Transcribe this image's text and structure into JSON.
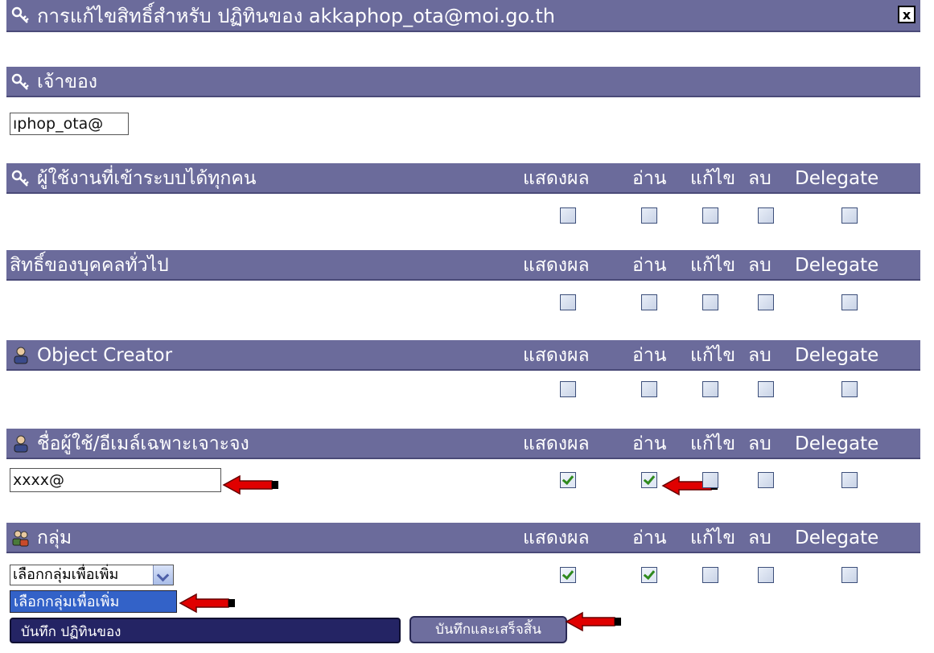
{
  "title_bar": {
    "title": "การแก้ไขสิทธิ์สำหรับ ปฏิทินของ akkaphop_ota@moi.go.th",
    "close_label": "x"
  },
  "owner": {
    "label": "เจ้าของ",
    "value": "ıphop_ota@"
  },
  "columns": [
    "แสดงผล",
    "อ่าน",
    "แก้ไข",
    "ลบ",
    "Delegate"
  ],
  "sections": [
    {
      "label": "ผู้ใช้งานที่เข้าระบบได้ทุกคน",
      "checks": [
        false,
        false,
        false,
        false,
        false
      ]
    },
    {
      "label": "สิทธิ์ของบุคคลทั่วไป",
      "checks": [
        false,
        false,
        false,
        false,
        false
      ]
    },
    {
      "label": "Object Creator",
      "checks": [
        false,
        false,
        false,
        false,
        false
      ]
    },
    {
      "label": "ชื่อผู้ใช้/อีเมล์เฉพาะเจาะจง",
      "checks": [
        true,
        true,
        false,
        false,
        false
      ],
      "input_value": "xxxx@"
    },
    {
      "label": "กลุ่ม",
      "checks": [
        true,
        true,
        false,
        false,
        false
      ],
      "select_value": "เลือกกลุ่มเพื่อเพิ่ม",
      "option_label": "เลือกกลุ่มเพื่อเพิ่ม"
    }
  ],
  "buttons": {
    "save": "บันทึก ปฏิทินของ",
    "save_finish": "บันทึกและเสร็จสิ้น"
  }
}
